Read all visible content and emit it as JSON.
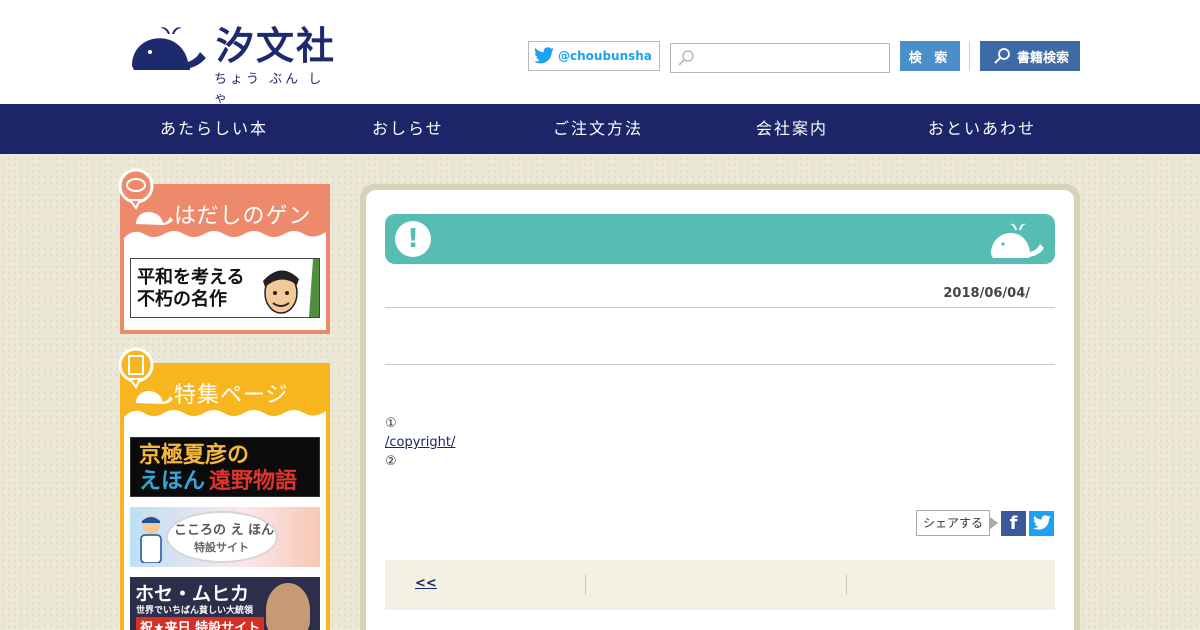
{
  "header": {
    "logo_title": "汐文社",
    "logo_subtitle": "ちょう ぶん しゃ",
    "twitter_handle": "@choubunsha",
    "search_placeholder": "",
    "search_button": "検 索",
    "book_search_button": "書籍検索"
  },
  "nav": {
    "items": [
      "あたらしい本",
      "おしらせ",
      "ご注文方法",
      "会社案内",
      "おといあわせ"
    ]
  },
  "sidebar": {
    "gen": {
      "title": "はだしのゲン",
      "banner_line1": "平和を考える",
      "banner_line2": "不朽の名作"
    },
    "special": {
      "title": "特集ページ",
      "banner1_line1": "京極夏彦の",
      "banner1_line2a": "えほん",
      "banner1_line2b": "遠野物語",
      "banner2_line1": "こころの え ほん",
      "banner2_line2": "特設サイト",
      "banner3_line1": "ホセ・ムヒカ",
      "banner3_line2": "世界でいちばん貧しい大統領",
      "banner3_line3": "祝★来日 特設サイト"
    }
  },
  "article": {
    "date": "2018/06/04/",
    "line1": "①",
    "link": "/copyright/",
    "line3": "②",
    "share_label": "シェアする",
    "prev_link": "<<"
  },
  "colors": {
    "navy": "#1b2567",
    "teal": "#56bdb3",
    "salmon": "#ee8a6c",
    "yellow": "#f7b520"
  },
  "icons": [
    "whale-logo-icon",
    "twitter-bird-icon",
    "search-icon",
    "exclamation-icon",
    "whale-icon",
    "facebook-icon",
    "twitter-icon"
  ]
}
